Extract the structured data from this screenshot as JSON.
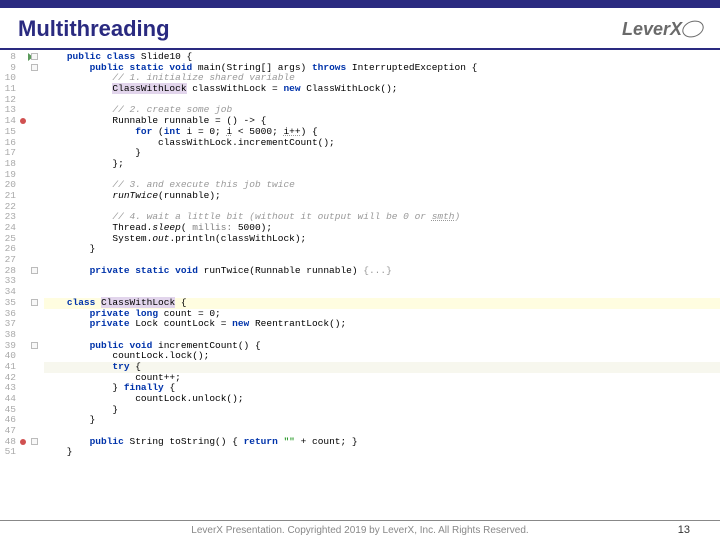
{
  "header": {
    "title": "Multithreading",
    "logo": "LeverX"
  },
  "footer": {
    "text": "LeverX Presentation. Copyrighted 2019 by LeverX, Inc. All Rights Reserved."
  },
  "page_number": "13",
  "gutter_start": 8,
  "line_count": 44,
  "breakpoints": [
    14,
    48
  ],
  "run_arrow_line": 8,
  "fold_lines": [
    8,
    9,
    28,
    35,
    39,
    48
  ],
  "highlight_yellow": 35,
  "highlight_cursor": 41,
  "code": {
    "l8": {
      "indent": 2,
      "kw1": "public class",
      "rest": " Slide10 {"
    },
    "l9": {
      "indent": 4,
      "kw1": "public static void",
      "name": " main(String[] args) ",
      "kw2": "throws",
      "rest": " InterruptedException {"
    },
    "l10": {
      "indent": 6,
      "comment": "// 1. initialize shared variable"
    },
    "l11": {
      "indent": 6,
      "hl1": "ClassWithLock",
      "mid": " classWithLock = ",
      "kw": "new",
      "rest": " ClassWithLock();"
    },
    "l13": {
      "indent": 6,
      "comment": "// 2. create some job"
    },
    "l14": {
      "indent": 6,
      "text": "Runnable runnable = () -> {"
    },
    "l15": {
      "indent": 8,
      "kw1": "for",
      "mid": " (",
      "kw2": "int",
      "rest1": " i = 0; ",
      "under1": "i",
      "rest2": " < 5000; ",
      "under2": "i++",
      "rest3": ") {"
    },
    "l16": {
      "indent": 10,
      "text": "classWithLock.incrementCount();"
    },
    "l17": {
      "indent": 8,
      "text": "}"
    },
    "l18": {
      "indent": 6,
      "text": "};"
    },
    "l20": {
      "indent": 6,
      "comment": "// 3. and execute this job twice"
    },
    "l21": {
      "indent": 6,
      "text1": "runTwice",
      "text2": "(runnable);"
    },
    "l23": {
      "indent": 6,
      "comment1": "// 4. wait a little bit (without it output will be 0 or ",
      "under": "smth",
      "comment2": ")"
    },
    "l24": {
      "indent": 6,
      "text1": "Thread.",
      "ital": "sleep",
      "text2": "(",
      "param": " millis: ",
      "text3": "5000);"
    },
    "l25": {
      "indent": 6,
      "text1": "System.",
      "ital1": "out",
      "text2": ".println(classWithLock);"
    },
    "l26": {
      "indent": 4,
      "text": "}"
    },
    "l28": {
      "indent": 4,
      "kw1": "private static void",
      "name": " runTwice(Runnable runnable) ",
      "fold": "{...}"
    },
    "l35": {
      "indent": 2,
      "kw1": "class",
      "sp": " ",
      "hl": "ClassWithLock",
      "rest": " {"
    },
    "l36": {
      "indent": 4,
      "kw1": "private long",
      "rest": " count = 0;"
    },
    "l37": {
      "indent": 4,
      "kw1": "private",
      "mid": " Lock countLock = ",
      "kw2": "new",
      "rest": " ReentrantLock();"
    },
    "l39": {
      "indent": 4,
      "kw1": "public void",
      "rest": " incrementCount() {"
    },
    "l40": {
      "indent": 6,
      "text": "countLock.lock();"
    },
    "l41": {
      "indent": 6,
      "kw": "try",
      "rest": " {"
    },
    "l42": {
      "indent": 8,
      "text": "count++;"
    },
    "l43": {
      "indent": 6,
      "text1": "} ",
      "kw": "finally",
      "rest": " {"
    },
    "l44": {
      "indent": 8,
      "text": "countLock.unlock();"
    },
    "l45": {
      "indent": 6,
      "text": "}"
    },
    "l46": {
      "indent": 4,
      "text": "}"
    },
    "l48": {
      "indent": 4,
      "kw1": "public",
      "mid": " String toString() { ",
      "kw2": "return",
      "sp": " ",
      "str": "\"\"",
      "rest": " + count; }"
    },
    "l51": {
      "indent": 2,
      "text": "}"
    }
  }
}
